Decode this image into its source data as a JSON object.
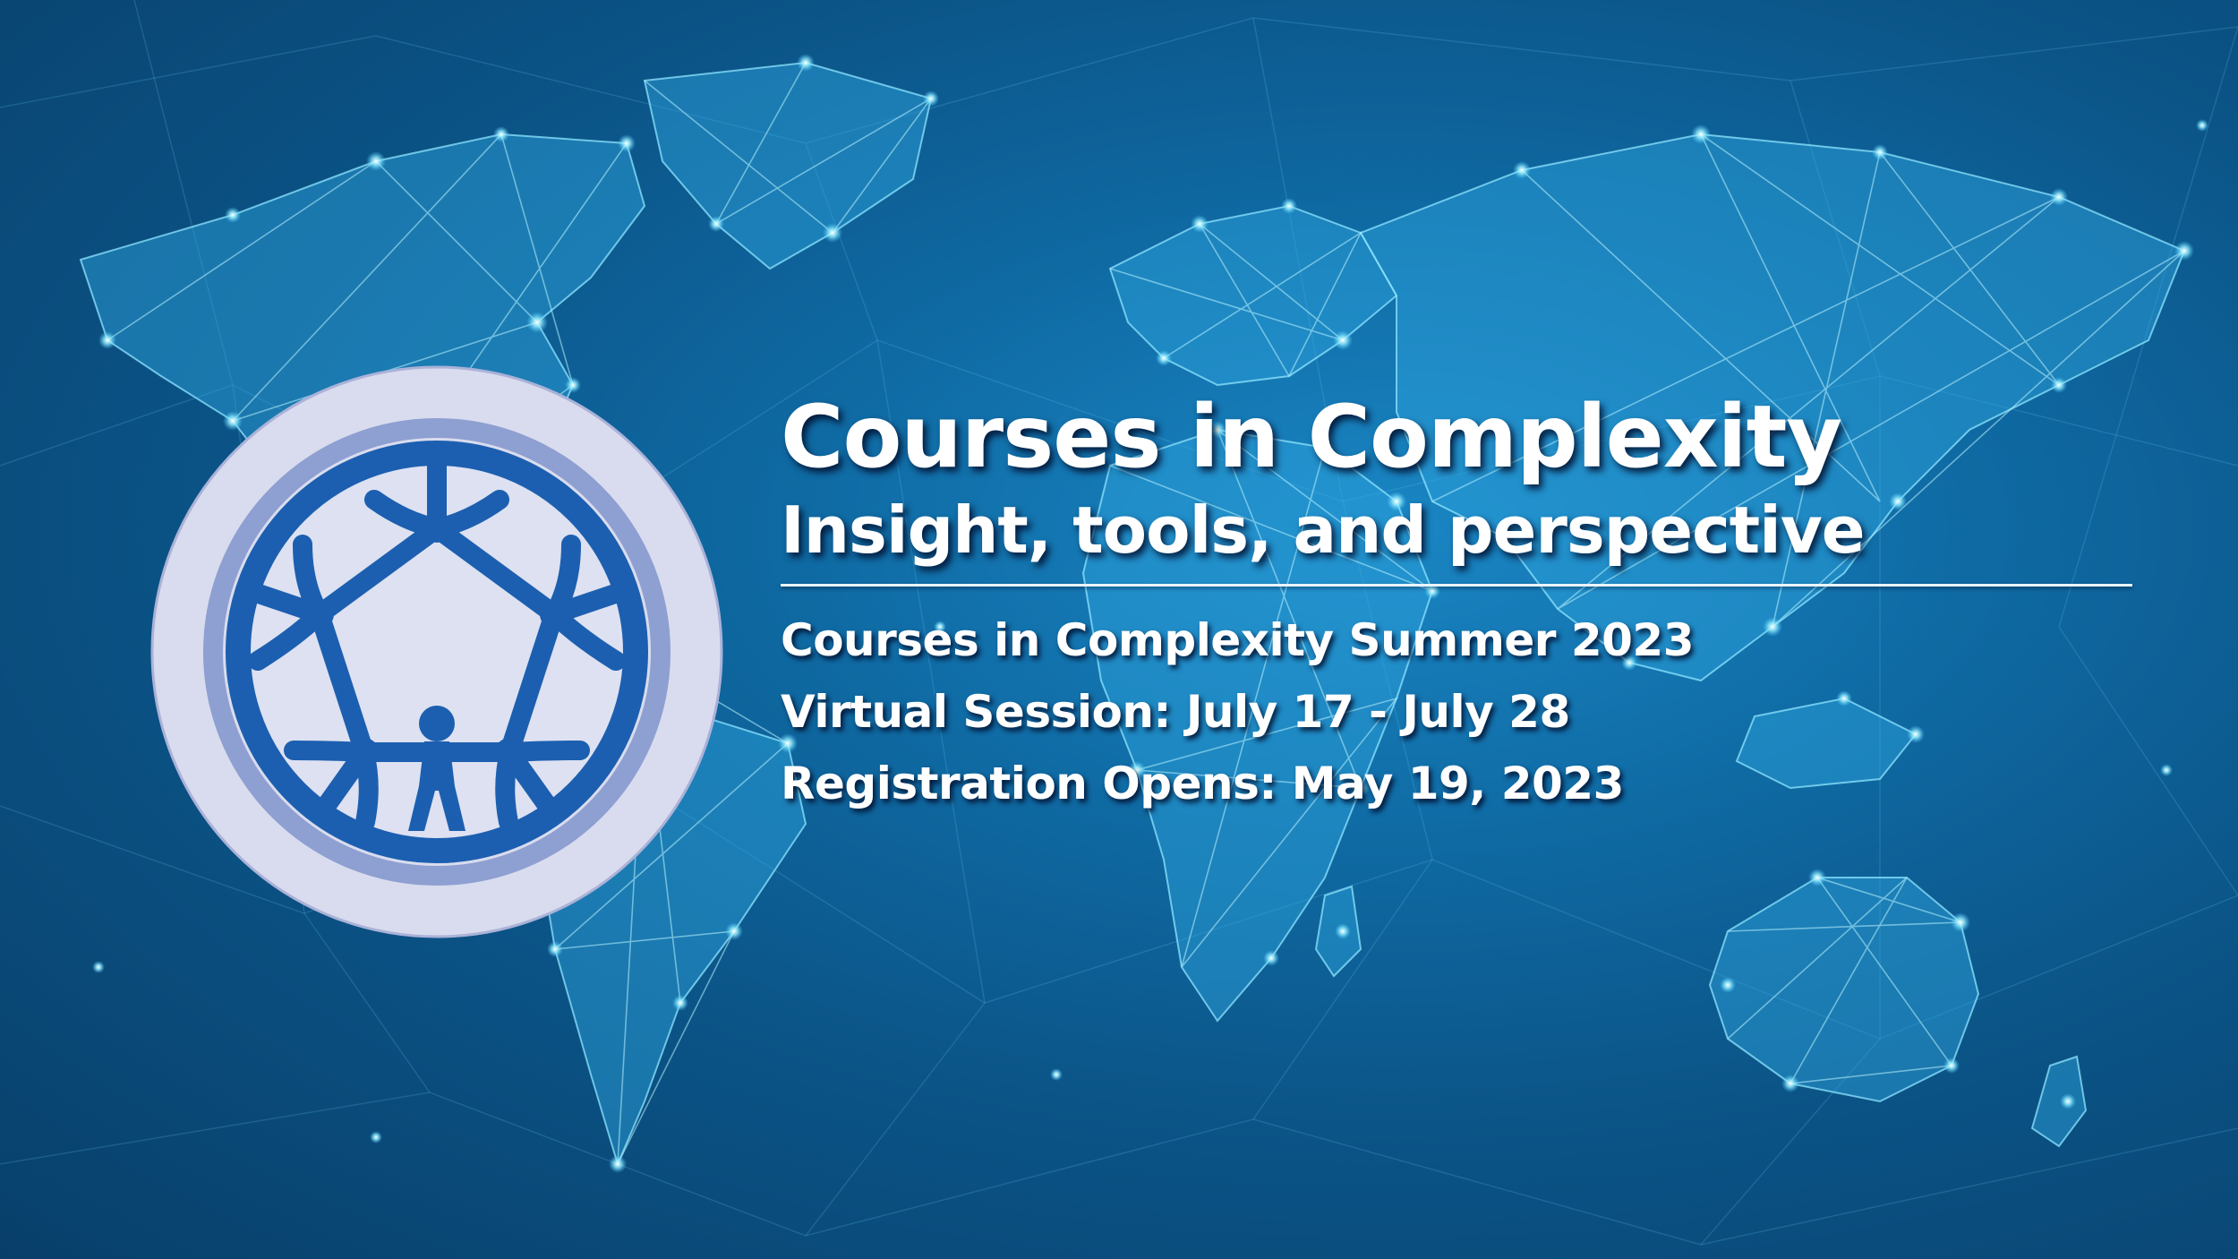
{
  "banner": {
    "title": "Courses in Complexity",
    "subtitle": "Insight, tools, and perspective",
    "details": [
      "Courses in Complexity Summer 2023",
      "Virtual Session: July 17 - July 28",
      "Registration Opens: May 19, 2023"
    ]
  },
  "background": {
    "description_icon": "world-network-map",
    "colors": {
      "deep_blue": "#083f6a",
      "mid_blue": "#0f6aa3",
      "glow_cyan": "#7fe4ff"
    }
  },
  "logo": {
    "icon": "people-ring-logo",
    "colors": {
      "outer_disc": "#d9dcee",
      "ring_light": "#8e9fd1",
      "ring_dark": "#1c5fb0",
      "inner_disc": "#dde1f1"
    }
  }
}
